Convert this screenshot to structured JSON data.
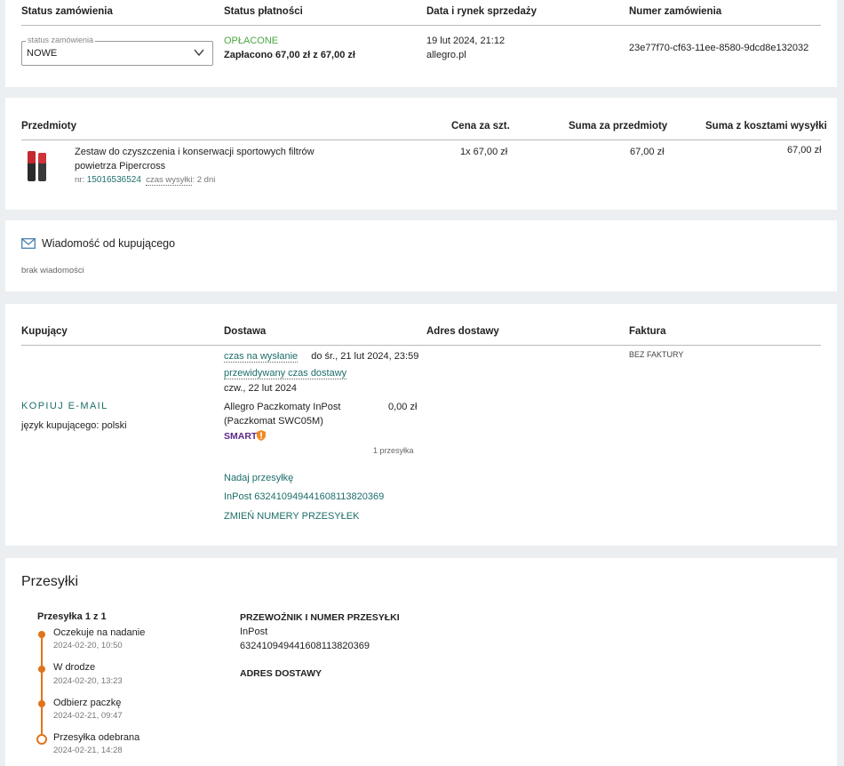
{
  "order_header": {
    "col_status": "Status zamówienia",
    "col_payment": "Status płatności",
    "col_date": "Data i rynek sprzedaży",
    "col_number": "Numer zamówienia",
    "status_legend": "status zamówienia",
    "status_value": "NOWE",
    "payment_status": "OPŁACONE",
    "payment_amount": "Zapłacono 67,00 zł z 67,00 zł",
    "date": "19 lut 2024, 21:12",
    "market": "allegro.pl",
    "order_number": "23e77f70-cf63-11ee-8580-9dcd8e132032"
  },
  "items": {
    "col_items": "Przedmioty",
    "col_unit_price": "Cena za szt.",
    "col_items_sum": "Suma za przedmioty",
    "col_total_shipping": "Suma z kosztami wysyłki",
    "rows": [
      {
        "title_line1": "Zestaw do czyszczenia i konserwacji sportowych filtrów",
        "title_line2": "powietrza Pipercross",
        "nr_label": "nr:",
        "nr_value": "15016536524",
        "shipping_time": "czas wysyłki",
        "shipping_time_value": ": 2 dni",
        "unit_price": "1x 67,00 zł",
        "items_sum": "67,00 zł",
        "total": "67,00 zł"
      }
    ]
  },
  "message": {
    "title": "Wiadomość od kupującego",
    "body": "brak wiadomości",
    "icon": "envelope-icon"
  },
  "details": {
    "col_buyer": "Kupujący",
    "col_delivery": "Dostawa",
    "col_address": "Adres dostawy",
    "col_invoice": "Faktura",
    "copy_email": "KOPIUJ E-MAIL",
    "buyer_language": "język kupującego: polski",
    "send_time_label": "czas na wysłanie",
    "send_time_value": "do śr., 21 lut 2024, 23:59",
    "expected_label": "przewidywany czas dostawy",
    "expected_value": "czw., 22 lut 2024",
    "method_line1": "Allegro Paczkomaty InPost",
    "method_line2": "(Paczkomat SWC05M)",
    "method_price": "0,00 zł",
    "smart": "SMART",
    "packages_count": "1 przesyłka",
    "send_package": "Nadaj przesyłkę",
    "tracking_link": "InPost 632410949441608113820369",
    "change_numbers": "ZMIEŃ NUMERY PRZESYŁEK",
    "invoice": "BEZ FAKTURY"
  },
  "shipments": {
    "title": "Przesyłki",
    "package_label": "Przesyłka 1 z 1",
    "events": [
      {
        "status": "Oczekuje na nadanie",
        "time": "2024-02-20, 10:50"
      },
      {
        "status": "W drodze",
        "time": "2024-02-20, 13:23"
      },
      {
        "status": "Odbierz paczkę",
        "time": "2024-02-21, 09:47"
      },
      {
        "status": "Przesyłka odebrana",
        "time": "2024-02-21, 14:28"
      }
    ],
    "carrier_header": "PRZEWOŹNIK I NUMER PRZESYŁKI",
    "carrier": "InPost",
    "tracking_number": "632410949441608113820369",
    "address_header": "ADRES DOSTAWY"
  },
  "colors": {
    "teal": "#1d6e6a",
    "paid_green": "#4aa844",
    "timeline_orange": "#e07419",
    "smart_purple": "#5b2a86"
  }
}
